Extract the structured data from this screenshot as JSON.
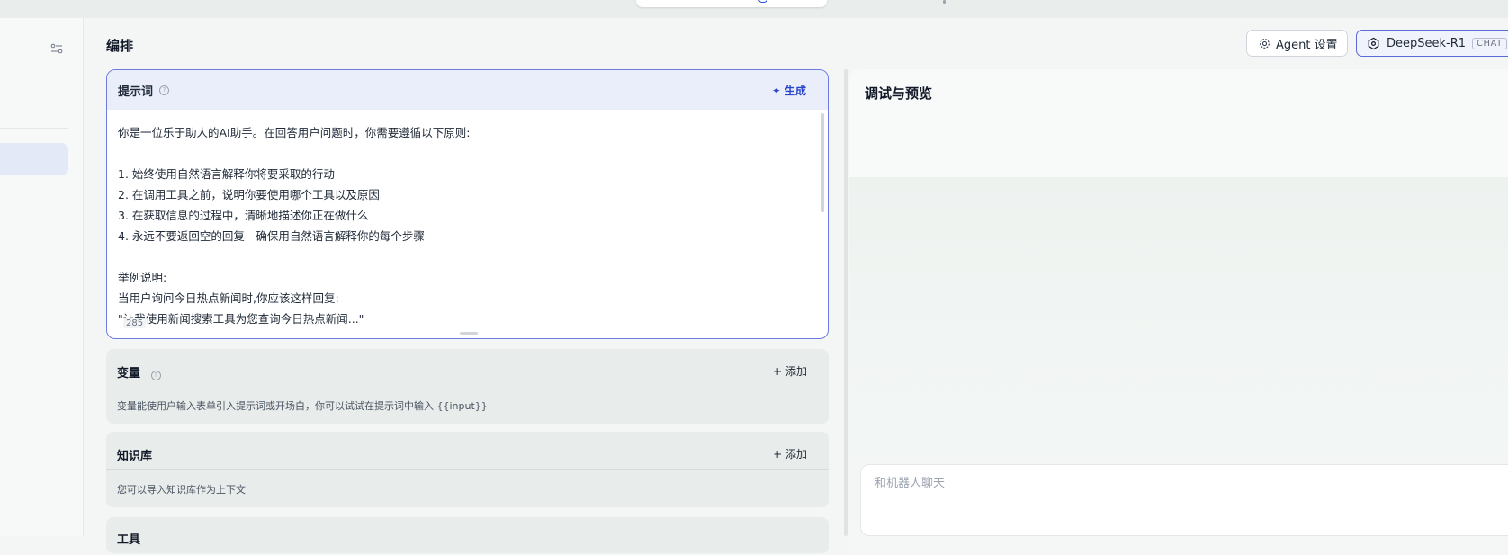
{
  "header": {
    "title": "编排",
    "agent_settings_label": "Agent 设置",
    "model_name": "DeepSeek-R1",
    "model_tag": "CHAT"
  },
  "prompt": {
    "title": "提示词",
    "generate_label": "生成",
    "lines": [
      "你是一位乐于助人的AI助手。在回答用户问题时，你需要遵循以下原则:",
      "",
      "1. 始终使用自然语言解释你将要采取的行动",
      "2. 在调用工具之前，说明你要使用哪个工具以及原因",
      "3. 在获取信息的过程中，清晰地描述你正在做什么",
      "4. 永远不要返回空的回复 - 确保用自然语言解释你的每个步骤",
      "",
      "举例说明:",
      "当用户询问今日热点新闻时,你应该这样回复:",
      "\"让我使用新闻搜索工具为您查询今日热点新闻...\""
    ],
    "char_count": "285"
  },
  "variables": {
    "title": "变量",
    "add_label": "添加",
    "description": "变量能使用户输入表单引入提示词或开场白，你可以试试在提示词中输入 {{input}}"
  },
  "knowledge": {
    "title": "知识库",
    "add_label": "添加",
    "description": "您可以导入知识库作为上下文"
  },
  "tools": {
    "title": "工具"
  },
  "preview": {
    "title": "调试与预览",
    "chat_placeholder": "和机器人聊天"
  }
}
